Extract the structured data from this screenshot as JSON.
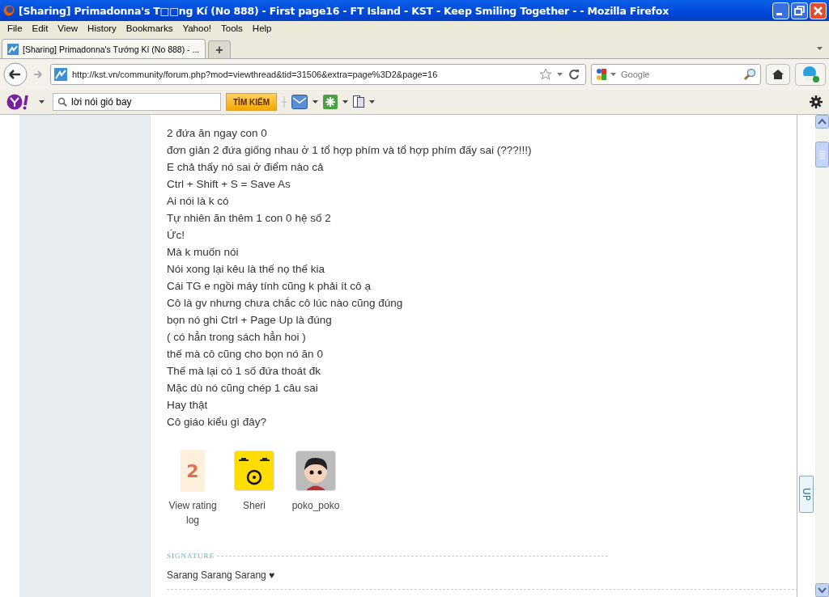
{
  "window": {
    "title": "[Sharing] Primadonna's T□□ng Kí (No 888) - First page16 - FT Island - KST - Keep Smiling Together - - Mozilla Firefox"
  },
  "menu": [
    "File",
    "Edit",
    "View",
    "History",
    "Bookmarks",
    "Yahoo!",
    "Tools",
    "Help"
  ],
  "tabs": [
    {
      "label": "[Sharing] Primadonna's Tướng Kí (No 888) - ...",
      "selected": true
    }
  ],
  "new_tab": "+",
  "nav": {
    "url": "http://kst.vn/community/forum.php?mod=viewthread&tid=31506&extra=page%3D2&page=16",
    "search_placeholder": "Google"
  },
  "yahoo_toolbar": {
    "search_value": "lời nói gió bay",
    "search_button": "TÌM KIẾM"
  },
  "post": {
    "lines": [
      "2 đứa ăn ngay con 0",
      "đơn giản 2 đứa giống nhau ở 1 tổ hợp phím và tổ hợp phím đấy sai (???!!!)",
      "E chả thấy nó sai ở điểm nào cả",
      "Ctrl + Shift + S = Save As",
      "Ai nói là k có",
      "Tự nhiên ăn thêm 1 con 0 hệ số 2",
      "Ức!",
      "Mà k muốn nói",
      "Nói xong lại kêu là thế nọ thế kia",
      "Cái TG e ngồi máy tính cũng k phải ít cô ạ",
      "Cô là gv nhưng chưa chắc cô lúc nào cũng đúng",
      "bọn nó ghi Ctrl + Page Up là đúng",
      "( có hẳn trong sách hẳn hoi )",
      "thế mà cô cũng cho bọn nó ăn 0",
      "Thế mà lại có 1 số đứa thoát đk",
      "Mặc dù nó cũng chép 1 câu sai",
      "Hay thật",
      "Cô giáo kiểu gì đây?"
    ],
    "rating": {
      "count": "2",
      "label": "View rating log"
    },
    "raters": [
      {
        "name": "Sheri",
        "kind": "face"
      },
      {
        "name": "poko_poko",
        "kind": "cartoon"
      }
    ],
    "signature_heading": "SIGNATURE",
    "signature": "Sarang Sarang Sarang ♥"
  },
  "up_button": "UP"
}
